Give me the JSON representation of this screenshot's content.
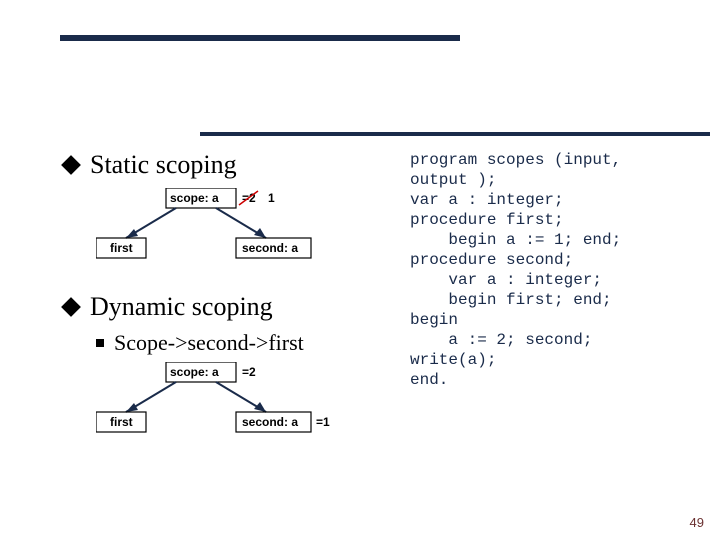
{
  "bullets": {
    "static": "Static scoping",
    "dynamic": "Dynamic scoping",
    "dynamic_sub": "Scope->second->first"
  },
  "diagram1": {
    "scope_label": "scope: a",
    "val_struck": "=2",
    "val_new": "1",
    "first_label": "first",
    "second_label": "second: a"
  },
  "diagram2": {
    "scope_label": "scope: a",
    "scope_val": "=2",
    "first_label": "first",
    "second_label": "second: a",
    "second_val": "=1"
  },
  "code": "program scopes (input,\noutput );\nvar a : integer;\nprocedure first;\n    begin a := 1; end;\nprocedure second;\n    var a : integer;\n    begin first; end;\nbegin\n    a := 2; second;\nwrite(a);\nend.",
  "page": "49",
  "colors": {
    "arrow": "#1a2b4a",
    "red": "#cc0000"
  }
}
